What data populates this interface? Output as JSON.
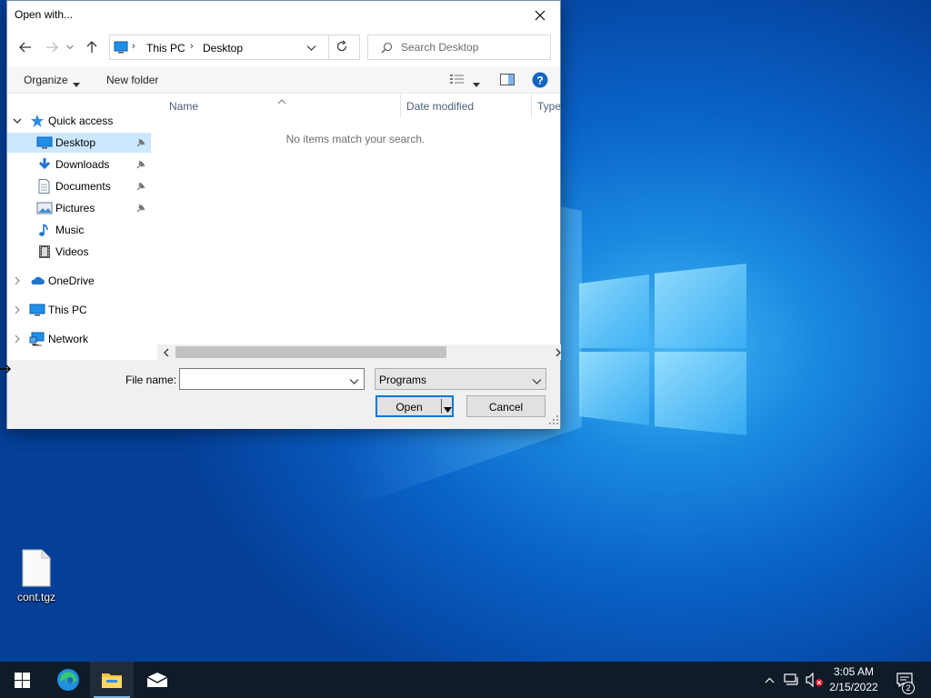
{
  "colors": {
    "accent": "#0078d7",
    "selection": "#cce8ff",
    "folder_blue": "#1e90e8",
    "taskbar": "#101b28"
  },
  "dialog": {
    "title": "Open with...",
    "address": {
      "crumbs": [
        "This PC",
        "Desktop"
      ]
    },
    "search_placeholder": "Search Desktop",
    "toolbar": {
      "organize": "Organize",
      "new_folder": "New folder"
    },
    "nav_tree": [
      {
        "label": "Quick access",
        "icon": "star-icon",
        "expanded": true
      },
      {
        "label": "Desktop",
        "icon": "desktop-icon",
        "pinned": true,
        "selected": true
      },
      {
        "label": "Downloads",
        "icon": "download-icon",
        "pinned": true
      },
      {
        "label": "Documents",
        "icon": "document-icon",
        "pinned": true
      },
      {
        "label": "Pictures",
        "icon": "pictures-icon",
        "pinned": true
      },
      {
        "label": "Music",
        "icon": "music-icon"
      },
      {
        "label": "Videos",
        "icon": "video-icon"
      },
      {
        "label": "OneDrive",
        "icon": "cloud-icon"
      },
      {
        "label": "This PC",
        "icon": "computer-icon"
      },
      {
        "label": "Network",
        "icon": "network-icon"
      }
    ],
    "columns": [
      "Name",
      "Date modified",
      "Type"
    ],
    "empty_message": "No items match your search.",
    "file_name_label": "File name:",
    "file_name_value": "",
    "file_type": "Programs",
    "open_label": "Open",
    "cancel_label": "Cancel"
  },
  "desktop": {
    "file_icon_label": "cont.tgz"
  },
  "taskbar": {
    "apps": [
      "start-icon",
      "edge-icon",
      "file-explorer-icon",
      "mail-icon"
    ],
    "time": "3:05 AM",
    "date": "2/15/2022",
    "notification_count": "2"
  }
}
